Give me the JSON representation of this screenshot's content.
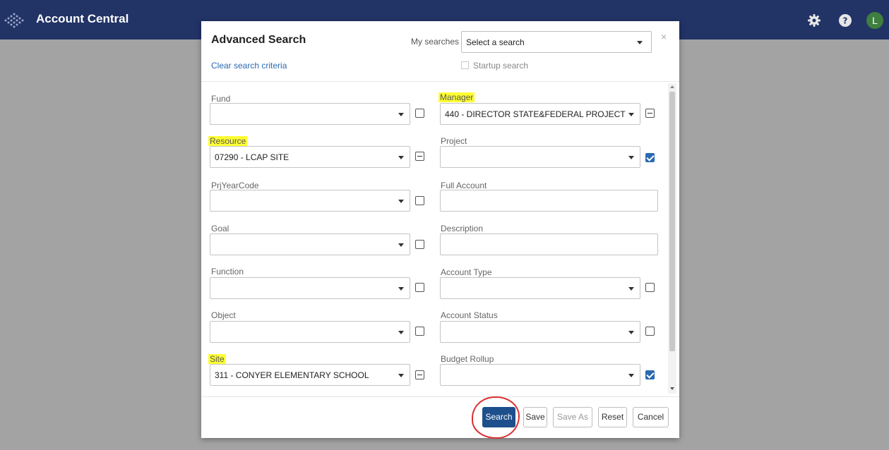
{
  "app": {
    "title": "Account Central",
    "avatar_initial": "L"
  },
  "header_icons": [
    "logo-icon",
    "gear-icon",
    "help-icon"
  ],
  "colors": {
    "topbar": "#223366",
    "primary": "#1d4f8c",
    "link": "#2a6ab0",
    "highlight": "#ffff33",
    "annotation": "#d93030"
  },
  "modal": {
    "title": "Advanced Search",
    "clear_link": "Clear search criteria",
    "my_searches_label": "My searches",
    "my_searches_value": "Select a search",
    "startup_label": "Startup search",
    "close_label": "×"
  },
  "fields": {
    "fund": {
      "label": "Fund",
      "value": "",
      "checkbox": "unchecked"
    },
    "resource": {
      "label": "Resource",
      "value": "07290 - LCAP SITE",
      "checkbox": "partial"
    },
    "prjyearcode": {
      "label": "PrjYearCode",
      "value": "",
      "checkbox": "unchecked"
    },
    "goal": {
      "label": "Goal",
      "value": "",
      "checkbox": "unchecked"
    },
    "function": {
      "label": "Function",
      "value": "",
      "checkbox": "unchecked"
    },
    "object": {
      "label": "Object",
      "value": "",
      "checkbox": "unchecked"
    },
    "site": {
      "label": "Site",
      "value": "311 - CONYER ELEMENTARY SCHOOL",
      "checkbox": "partial"
    },
    "manager": {
      "label": "Manager",
      "value": "440 - DIRECTOR STATE&FEDERAL PROJECT",
      "checkbox": "partial"
    },
    "project": {
      "label": "Project",
      "value": "",
      "checkbox": "checked"
    },
    "full_account": {
      "label": "Full Account",
      "value": ""
    },
    "description": {
      "label": "Description",
      "value": ""
    },
    "account_type": {
      "label": "Account Type",
      "value": "",
      "checkbox": "unchecked"
    },
    "account_status": {
      "label": "Account Status",
      "value": "",
      "checkbox": "unchecked"
    },
    "budget_rollup": {
      "label": "Budget Rollup",
      "value": "",
      "checkbox": "checked"
    }
  },
  "footer": {
    "search": "Search",
    "save": "Save",
    "save_as": "Save As",
    "reset": "Reset",
    "cancel": "Cancel"
  }
}
